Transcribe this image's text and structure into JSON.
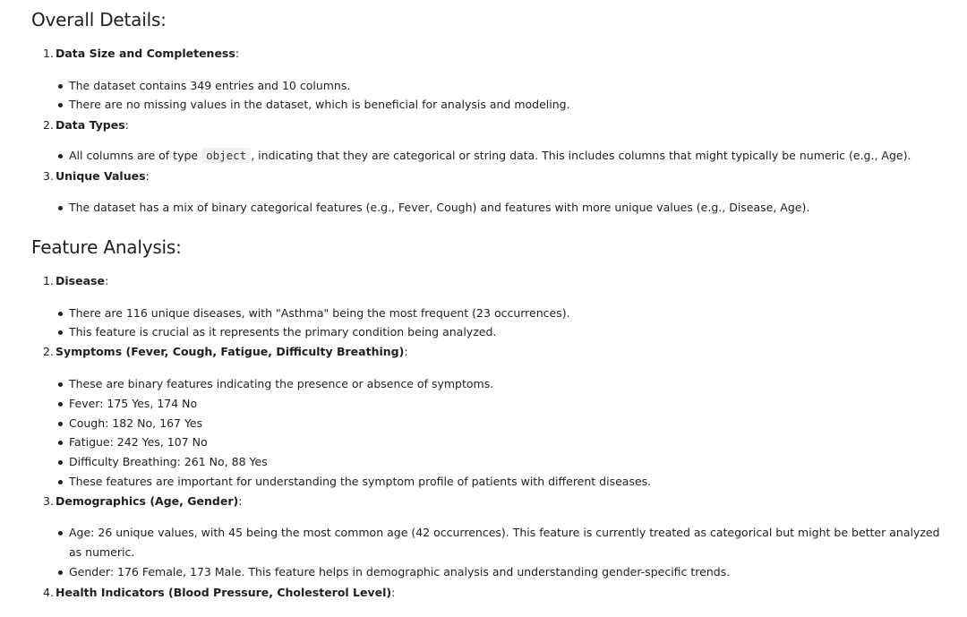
{
  "sections": [
    {
      "title": "Overall Details:",
      "items": [
        {
          "num": "1.",
          "label": "Data Size and Completeness",
          "bullets": [
            "The dataset contains 349 entries and 10 columns.",
            "There are no missing values in the dataset, which is beneficial for analysis and modeling."
          ]
        },
        {
          "num": "2.",
          "label": "Data Types",
          "bullet_parts": {
            "before": "All columns are of type ",
            "code": "object",
            "after": ", indicating that they are categorical or string data. This includes columns that might typically be numeric (e.g., Age)."
          }
        },
        {
          "num": "3.",
          "label": "Unique Values",
          "bullets": [
            "The dataset has a mix of binary categorical features (e.g., Fever, Cough) and features with more unique values (e.g., Disease, Age)."
          ]
        }
      ]
    },
    {
      "title": "Feature Analysis:",
      "items": [
        {
          "num": "1.",
          "label": "Disease",
          "bullets": [
            "There are 116 unique diseases, with \"Asthma\" being the most frequent (23 occurrences).",
            "This feature is crucial as it represents the primary condition being analyzed."
          ]
        },
        {
          "num": "2.",
          "label": "Symptoms (Fever, Cough, Fatigue, Difficulty Breathing)",
          "bullets": [
            "These are binary features indicating the presence or absence of symptoms.",
            "Fever: 175 Yes, 174 No",
            "Cough: 182 No, 167 Yes",
            "Fatigue: 242 Yes, 107 No",
            "Difficulty Breathing: 261 No, 88 Yes",
            "These features are important for understanding the symptom profile of patients with different diseases."
          ]
        },
        {
          "num": "3.",
          "label": "Demographics (Age, Gender)",
          "bullets": [
            "Age: 26 unique values, with 45 being the most common age (42 occurrences). This feature is currently treated as categorical but might be better analyzed as numeric.",
            "Gender: 176 Female, 173 Male. This feature helps in demographic analysis and understanding gender-specific trends."
          ]
        },
        {
          "num": "4.",
          "label": "Health Indicators (Blood Pressure, Cholesterol Level)",
          "bullets": []
        }
      ]
    }
  ],
  "colon": ":"
}
